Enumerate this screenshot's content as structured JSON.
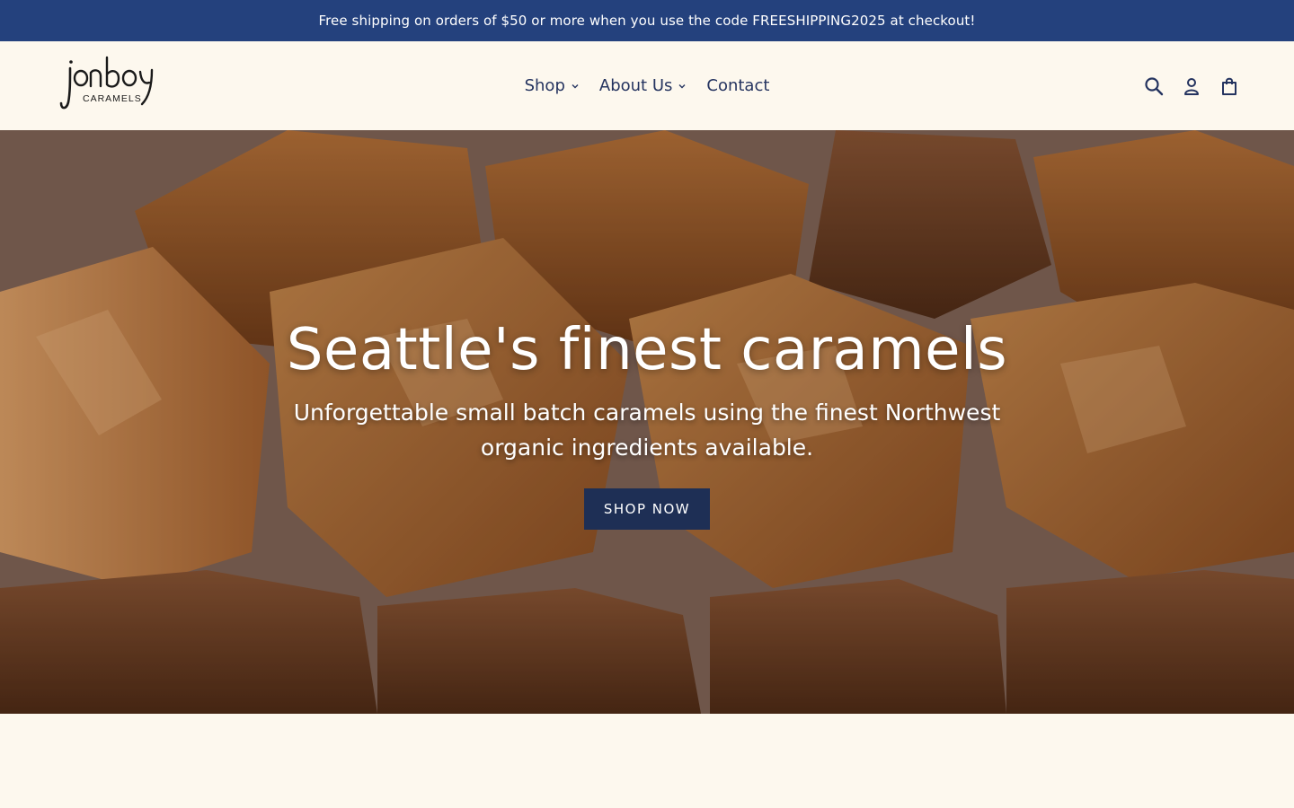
{
  "announcement": {
    "text": "Free shipping on orders of $50 or more when you use the code FREESHIPPING2025 at checkout!",
    "background_color": "#24417d"
  },
  "header": {
    "logo": {
      "wordmark": "jonboy",
      "subtext": "CARAMELS"
    },
    "nav": [
      {
        "label": "Shop",
        "has_dropdown": true
      },
      {
        "label": "About Us",
        "has_dropdown": true
      },
      {
        "label": "Contact",
        "has_dropdown": false
      }
    ],
    "icons": [
      "search-icon",
      "account-icon",
      "cart-icon"
    ]
  },
  "hero": {
    "title": "Seattle's finest caramels",
    "subtitle": "Unforgettable small batch caramels using the finest Northwest organic ingredients available.",
    "button_label": "SHOP NOW",
    "button_color": "#1e2f55"
  },
  "colors": {
    "page_background": "#fdf8ee",
    "nav_text": "#24335f"
  }
}
